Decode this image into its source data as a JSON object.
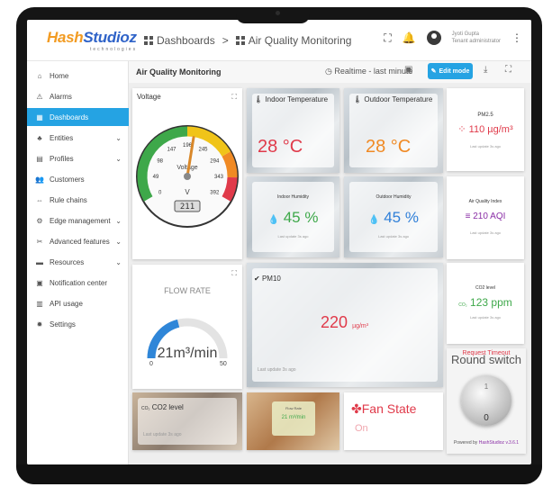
{
  "brand": {
    "name_a": "Hash",
    "name_b": "Studioz",
    "tagline": "technologies"
  },
  "breadcrumb": {
    "first": "Dashboards",
    "sep": ">",
    "second": "Air Quality Monitoring"
  },
  "user": {
    "name": "Jyoti Gupta",
    "role": "Tenant administrator"
  },
  "sidebar": [
    {
      "label": "Home",
      "icon": "home-icon",
      "glyph": "⌂",
      "chev": false
    },
    {
      "label": "Alarms",
      "icon": "alarm-icon",
      "glyph": "⚠",
      "chev": false
    },
    {
      "label": "Dashboards",
      "icon": "dashboard-icon",
      "glyph": "▦",
      "chev": false,
      "active": true
    },
    {
      "label": "Entities",
      "icon": "entities-icon",
      "glyph": "♣",
      "chev": true
    },
    {
      "label": "Profiles",
      "icon": "profiles-icon",
      "glyph": "▤",
      "chev": true
    },
    {
      "label": "Customers",
      "icon": "customers-icon",
      "glyph": "👥",
      "chev": false
    },
    {
      "label": "Rule chains",
      "icon": "rule-chain-icon",
      "glyph": "⇔",
      "chev": false
    },
    {
      "label": "Edge management",
      "icon": "edge-icon",
      "glyph": "⚙",
      "chev": true
    },
    {
      "label": "Advanced features",
      "icon": "tools-icon",
      "glyph": "✂",
      "chev": true
    },
    {
      "label": "Resources",
      "icon": "folder-icon",
      "glyph": "▬",
      "chev": true
    },
    {
      "label": "Notification center",
      "icon": "notification-icon",
      "glyph": "▣",
      "chev": false
    },
    {
      "label": "API usage",
      "icon": "api-icon",
      "glyph": "▥",
      "chev": false
    },
    {
      "label": "Settings",
      "icon": "settings-icon",
      "glyph": "✹",
      "chev": false
    }
  ],
  "content": {
    "title": "Air Quality Monitoring",
    "realtime": "Realtime - last minute",
    "edit": "Edit mode"
  },
  "voltage": {
    "title": "Voltage",
    "unit": "V",
    "label": "Voltage",
    "lcd": "211",
    "value": 211,
    "min": 0,
    "max": 392,
    "ticks": [
      "0",
      "49",
      "98",
      "147",
      "196",
      "245",
      "294",
      "343",
      "392"
    ]
  },
  "indoor_temp": {
    "title": "Indoor Temperature",
    "value": "28 °C"
  },
  "outdoor_temp": {
    "title": "Outdoor Temperature",
    "value": "28 °C"
  },
  "indoor_hum": {
    "title": "Indoor Humidity",
    "value": "45 %",
    "updated": "Last update 3s ago"
  },
  "outdoor_hum": {
    "title": "Outdoor Humidity",
    "value": "45 %",
    "updated": "Last update 3s ago"
  },
  "pm25": {
    "title": "PM2.5",
    "value": "110 µg/m³",
    "updated": "Last update 3s ago"
  },
  "aqi": {
    "title": "Air Quality Index",
    "value": "210 AQI",
    "updated": "Last update 3s ago"
  },
  "co2_right": {
    "title": "CO2 level",
    "value": "123 ppm",
    "updated": "Last update 3s ago"
  },
  "flow": {
    "title": "FLOW RATE",
    "value": "21m³/min",
    "min": "0",
    "max": "50",
    "level": 21
  },
  "pm10": {
    "title": "PM10",
    "value": "220",
    "unit": "µg/m³",
    "updated": "Last update 3s ago"
  },
  "round_switch": {
    "title": "Round switch",
    "overlay": "Request Timeout",
    "label_top": "1",
    "label_bottom": "0"
  },
  "co2_bottom": {
    "title": "CO2 level",
    "updated": "Last update 3s ago"
  },
  "flow_small": {
    "title": "Flow Rate",
    "value": "21 m³/min"
  },
  "fan": {
    "title": "Fan State",
    "state": "On"
  },
  "footer": {
    "text": "Powered by ",
    "link": "HashStudioz v.3.6.1"
  },
  "colors": {
    "accent": "#25a3e3",
    "red": "#e03a4a",
    "orange": "#f08a24",
    "green": "#3ea84a",
    "purple": "#8a2ea6"
  }
}
